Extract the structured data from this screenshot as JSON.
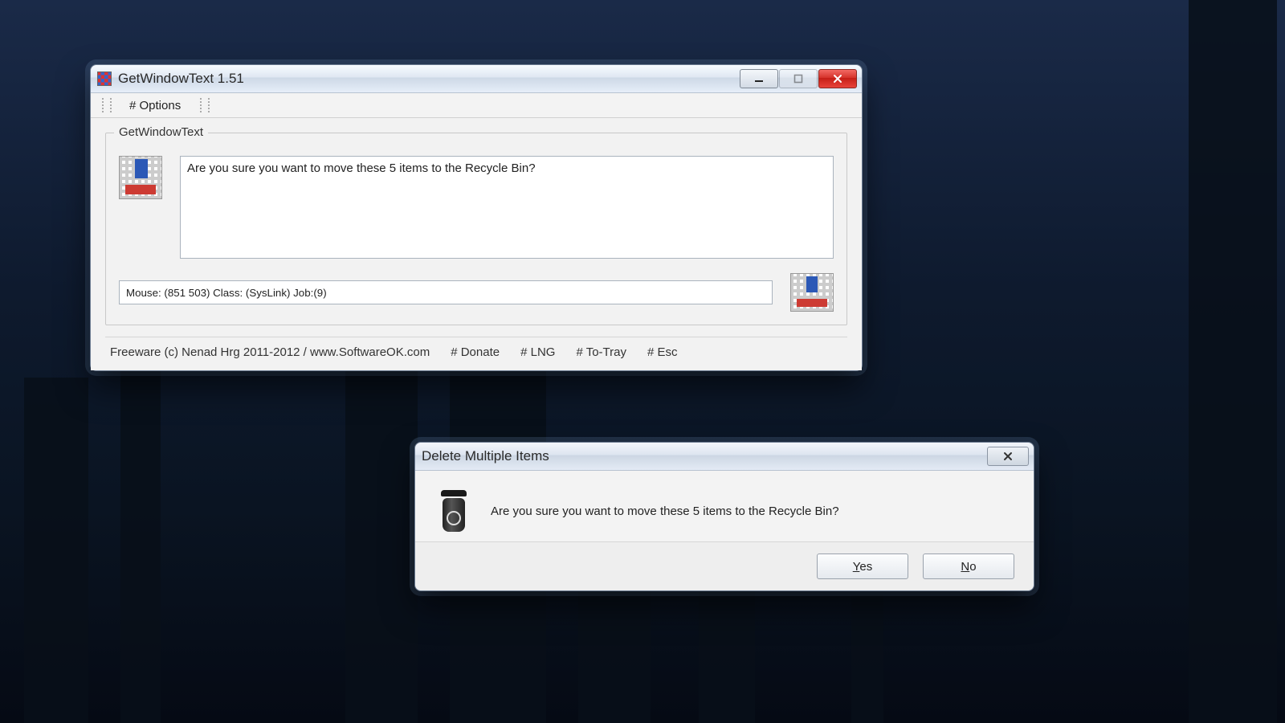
{
  "win1": {
    "title": "GetWindowText 1.51",
    "menu": {
      "options": "# Options"
    },
    "group_legend": "GetWindowText",
    "captured_text": "Are you sure you want to move these 5 items to the Recycle Bin?",
    "status": "Mouse: (851 503) Class: (SysLink) Job:(9)",
    "footer": {
      "credits": "Freeware (c) Nenad Hrg 2011-2012 / www.SoftwareOK.com",
      "donate": "# Donate",
      "lng": "# LNG",
      "totray": "# To-Tray",
      "esc": "# Esc"
    }
  },
  "win2": {
    "title": "Delete Multiple Items",
    "message": "Are you sure you want to move these 5 items to the Recycle Bin?",
    "yes": "Yes",
    "no": "No"
  }
}
